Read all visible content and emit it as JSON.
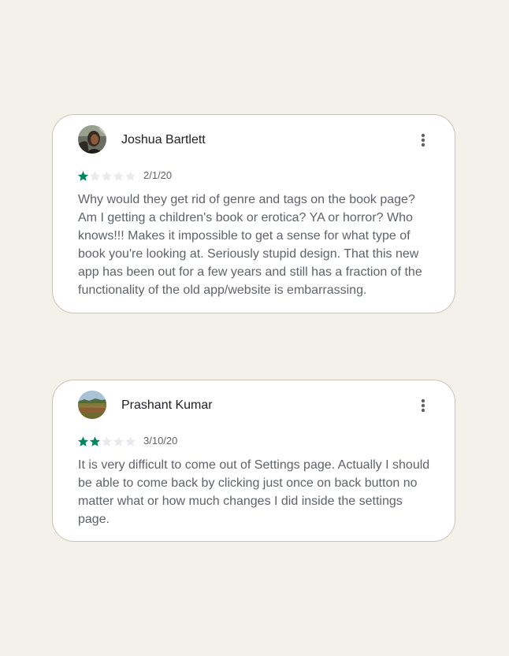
{
  "reviews": [
    {
      "author": "Joshua Bartlett",
      "avatar_icon": "user-photo-avatar",
      "rating": 1,
      "max_rating": 5,
      "date": "2/1/20",
      "text": "Why would they get rid of genre and tags on the book page? Am I getting a children's book or erotica? YA or horror? Who knows!!! Makes it impossible to get a sense for what type of book you're looking at. Seriously stupid design. That this new app has been out for a few years and still has a fraction of the functionality of the old app/website is embarrassing.",
      "menu_icon": "more-vert-icon"
    },
    {
      "author": "Prashant Kumar",
      "avatar_icon": "landscape-photo-avatar",
      "rating": 2,
      "max_rating": 5,
      "date": "3/10/20",
      "text": "It is very difficult to come out of Settings page. Actually I should be able to come back by clicking just once on back button no matter what or how much changes I did inside the settings page.",
      "menu_icon": "more-vert-icon"
    }
  ],
  "colors": {
    "background": "#f4f1eb",
    "card": "#ffffff",
    "star_filled": "#01875f",
    "star_empty": "#e8eaed",
    "author_text": "#202124",
    "body_text": "#5f6368"
  }
}
